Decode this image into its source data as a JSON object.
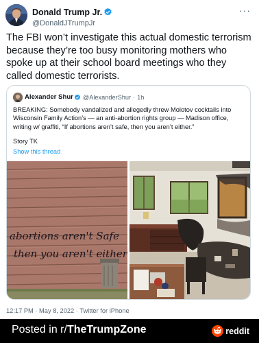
{
  "tweet": {
    "display_name": "Donald Trump Jr.",
    "handle": "@DonaldJTrumpJr",
    "more_icon": "more-horizontal-icon",
    "text": "The FBI won’t investigate this actual domestic terrorism because they’re too busy monitoring mothers who spoke up at their school board meetings who they called domestic terrorists.",
    "timestamp": "12:17 PM · May 8, 2022 · Twitter for iPhone"
  },
  "quoted": {
    "display_name": "Alexander Shur",
    "handle": "@AlexanderShur",
    "separator": "·",
    "time": "1h",
    "text": "BREAKING: Somebody vandalized and allegedly threw Molotov cocktails into Wisconsin Family Action’s — an anti-abortion rights group — Madison office, writing w/ graffiti, “If abortions aren’t safe, then you aren’t either.”",
    "story": "Story TK",
    "show_thread": "Show this thread",
    "photo_left": {
      "graffiti_line1": "abortions aren't Safe",
      "graffiti_line2": "then you aren't either"
    }
  },
  "footer": {
    "posted_prefix": "Posted in r/",
    "subreddit": "TheTrumpZone",
    "brand": "reddit"
  },
  "colors": {
    "verified_blue": "#1d9bf0",
    "link_blue": "#1d9bf0",
    "secondary_text": "#536471",
    "footer_bg": "#000000",
    "reddit_orange": "#ff4500"
  }
}
